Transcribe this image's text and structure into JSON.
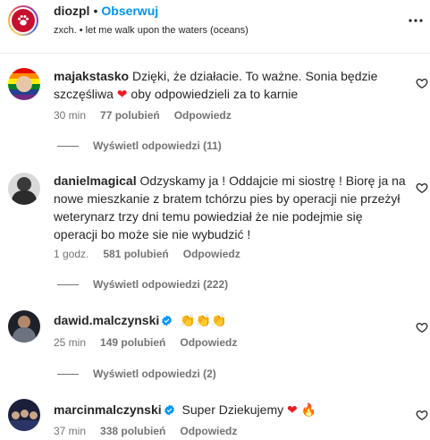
{
  "post": {
    "username": "diozpl",
    "separator": "•",
    "follow_label": "Obserwuj",
    "audio": "zxch. • let me walk upon the waters (oceans)",
    "more_icon": "more-horizontal-icon"
  },
  "comments": [
    {
      "username": "majakstasko",
      "text_before": "Dzięki, że działacie. To ważne. Sonia będzie szczęśliwa",
      "emoji": "❤",
      "text_after": "oby odpowiedzieli za to karnie",
      "time": "30 min",
      "likes": "77 polubień",
      "reply": "Odpowiedz",
      "view_replies": "Wyświetl odpowiedzi (11)"
    },
    {
      "username": "danielmagical",
      "text": "Odzyskamy ja ! Oddajcie mi siostrę ! Biorę ja na nowe mieszkanie z bratem tchórzu pies by operacji nie przeżył weterynarz trzy dni temu powiedział że nie podejmie się operacji bo może sie nie wybudzić !",
      "time": "1 godz.",
      "likes": "581 polubień",
      "reply": "Odpowiedz",
      "view_replies": "Wyświetl odpowiedzi (222)"
    },
    {
      "username": "dawid.malczynski",
      "verified": true,
      "text": "👏👏👏",
      "time": "25 min",
      "likes": "149 polubień",
      "reply": "Odpowiedz",
      "view_replies": "Wyświetl odpowiedzi (2)"
    },
    {
      "username": "marcinmalczynski",
      "verified": true,
      "text_before": "Super Dziekujemy",
      "emoji": "❤",
      "emoji2": "🔥",
      "time": "37 min",
      "likes": "338 polubień",
      "reply": "Odpowiedz"
    }
  ],
  "colors": {
    "follow": "#0095f6",
    "secondary_text": "#737373",
    "verified": "#0095f6",
    "heart": "#ed1c24"
  }
}
